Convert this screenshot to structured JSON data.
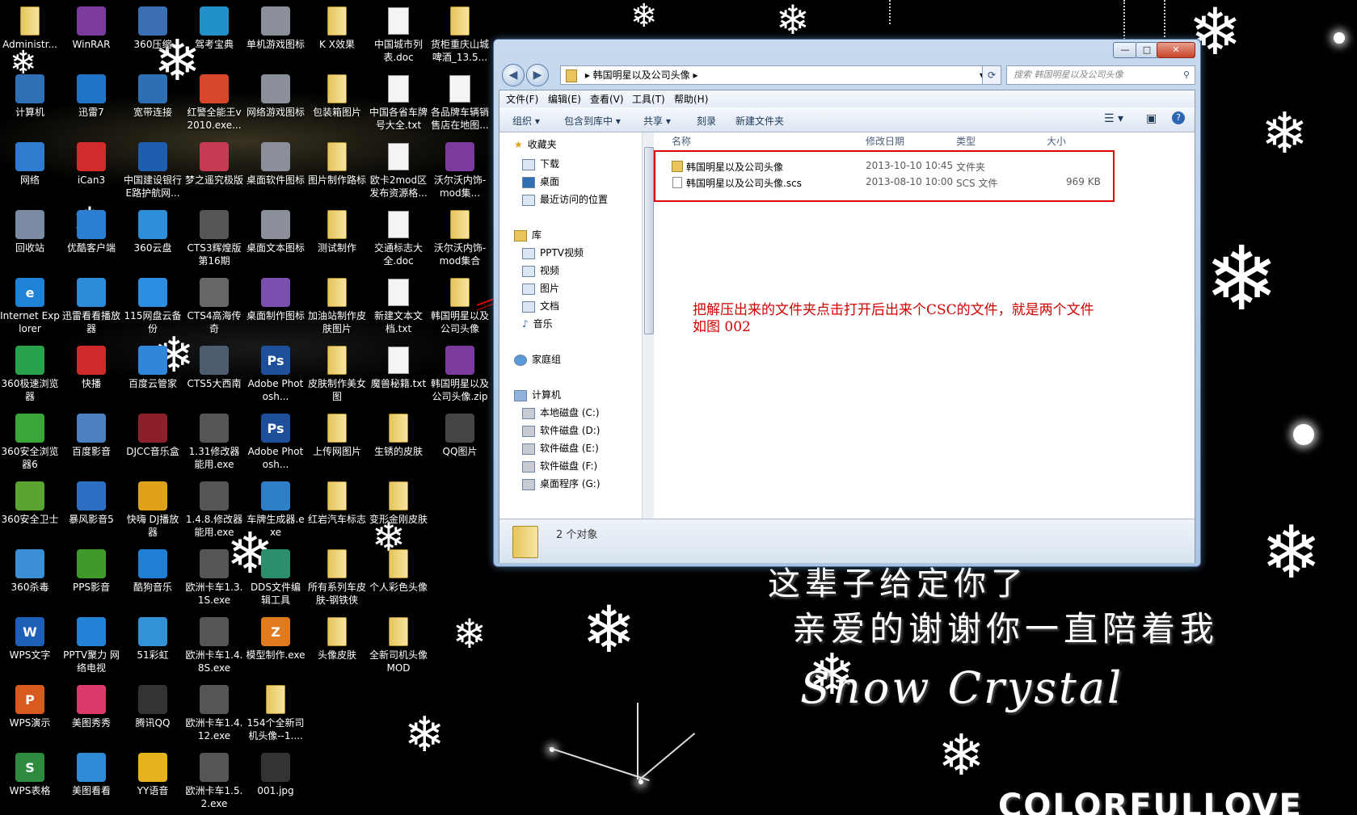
{
  "desktop_icons": [
    {
      "label": "Administr...",
      "kind": "folder"
    },
    {
      "label": "计算机",
      "kind": "app",
      "color": "#2f6fb5"
    },
    {
      "label": "网络",
      "kind": "app",
      "color": "#2e7bd0"
    },
    {
      "label": "回收站",
      "kind": "app",
      "color": "#7a8ba3"
    },
    {
      "label": "Internet Explorer",
      "kind": "app",
      "color": "#1e82d6",
      "glyph": "e"
    },
    {
      "label": "360极速浏览器",
      "kind": "app",
      "color": "#2aa24b"
    },
    {
      "label": "360安全浏览器6",
      "kind": "app",
      "color": "#3aa63a"
    },
    {
      "label": "360安全卫士",
      "kind": "app",
      "color": "#5aa531"
    },
    {
      "label": "360杀毒",
      "kind": "app",
      "color": "#3b8fd4"
    },
    {
      "label": "WPS文字",
      "kind": "app",
      "color": "#1e5fb8",
      "glyph": "W"
    },
    {
      "label": "WPS演示",
      "kind": "app",
      "color": "#d85a1f",
      "glyph": "P"
    },
    {
      "label": "WPS表格",
      "kind": "app",
      "color": "#2e8b3e",
      "glyph": "S"
    },
    {
      "label": "WinRAR",
      "kind": "app",
      "color": "#7b3b9e"
    },
    {
      "label": "迅雷7",
      "kind": "app",
      "color": "#1f74c7"
    },
    {
      "label": "iCan3",
      "kind": "app",
      "color": "#d22b2b"
    },
    {
      "label": "优酷客户端",
      "kind": "app",
      "color": "#2a7fd2"
    },
    {
      "label": "迅雷看看播放器",
      "kind": "app",
      "color": "#2c8ad8"
    },
    {
      "label": "快播",
      "kind": "app",
      "color": "#cf2a2a"
    },
    {
      "label": "百度影音",
      "kind": "app",
      "color": "#4a7fc0"
    },
    {
      "label": "暴风影音5",
      "kind": "app",
      "color": "#2d6fc3"
    },
    {
      "label": "PPS影音",
      "kind": "app",
      "color": "#3e9a2b"
    },
    {
      "label": "PPTV聚力 网络电视",
      "kind": "app",
      "color": "#2283d6"
    },
    {
      "label": "美图秀秀",
      "kind": "app",
      "color": "#d93a6a"
    },
    {
      "label": "美图看看",
      "kind": "app",
      "color": "#2f8ad6"
    },
    {
      "label": "360压缩",
      "kind": "app",
      "color": "#3b6fb4"
    },
    {
      "label": "宽带连接",
      "kind": "app",
      "color": "#2c6fb2"
    },
    {
      "label": "中国建设银行E路护航网...",
      "kind": "app",
      "color": "#1d5fae"
    },
    {
      "label": "360云盘",
      "kind": "app",
      "color": "#2d8ed9"
    },
    {
      "label": "115网盘云备份",
      "kind": "app",
      "color": "#2b8ee0"
    },
    {
      "label": "百度云管家",
      "kind": "app",
      "color": "#2f86db"
    },
    {
      "label": "DJCC音乐盒",
      "kind": "app",
      "color": "#8b1f2a"
    },
    {
      "label": "快嗨 DJ播放器",
      "kind": "app",
      "color": "#e0a21b"
    },
    {
      "label": "酷狗音乐",
      "kind": "app",
      "color": "#1f7fd5"
    },
    {
      "label": "51彩虹",
      "kind": "app",
      "color": "#3391d6"
    },
    {
      "label": "腾讯QQ",
      "kind": "app",
      "color": "#333333"
    },
    {
      "label": "YY语音",
      "kind": "app",
      "color": "#e6b31c"
    },
    {
      "label": "驾考宝典",
      "kind": "app",
      "color": "#2391c9"
    },
    {
      "label": "红警全能王v2010.exe...",
      "kind": "app",
      "color": "#d8462a"
    },
    {
      "label": "梦之遥究极版",
      "kind": "app",
      "color": "#c63a52"
    },
    {
      "label": "CTS3辉煌版第16期",
      "kind": "app",
      "color": "#555555"
    },
    {
      "label": "CTS4高海传奇",
      "kind": "app",
      "color": "#666666"
    },
    {
      "label": "CTS5大西南",
      "kind": "app",
      "color": "#4d5c6e"
    },
    {
      "label": "1.31修改器能用.exe",
      "kind": "app",
      "color": "#555555"
    },
    {
      "label": "1.4.8.修改器能用.exe",
      "kind": "app",
      "color": "#555555"
    },
    {
      "label": "欧洲卡车1.3.1S.exe",
      "kind": "app",
      "color": "#555555"
    },
    {
      "label": "欧洲卡车1.4.8S.exe",
      "kind": "app",
      "color": "#555555"
    },
    {
      "label": "欧洲卡车1.4.12.exe",
      "kind": "app",
      "color": "#555555"
    },
    {
      "label": "欧洲卡车1.5.2.exe",
      "kind": "app",
      "color": "#555555"
    },
    {
      "label": "单机游戏图标",
      "kind": "app",
      "color": "#8a8f99"
    },
    {
      "label": "网络游戏图标",
      "kind": "app",
      "color": "#8a8f99"
    },
    {
      "label": "桌面软件图标",
      "kind": "app",
      "color": "#8a8f99"
    },
    {
      "label": "桌面文本图标",
      "kind": "app",
      "color": "#8a8f99"
    },
    {
      "label": "桌面制作图标",
      "kind": "app",
      "color": "#7a4fb0"
    },
    {
      "label": "Adobe Photosh...",
      "kind": "app",
      "color": "#1d4f9a",
      "glyph": "Ps"
    },
    {
      "label": "Adobe Photosh...",
      "kind": "app",
      "color": "#1d4f9a",
      "glyph": "Ps"
    },
    {
      "label": "车牌生成器.exe",
      "kind": "app",
      "color": "#2d7fc8"
    },
    {
      "label": "DDS文件编辑工具",
      "kind": "app",
      "color": "#2b8f6c"
    },
    {
      "label": "模型制作.exe",
      "kind": "app",
      "color": "#e07a1f",
      "glyph": "Z"
    },
    {
      "label": "154个全新司机头像--1....",
      "kind": "folder"
    },
    {
      "label": "001.jpg",
      "kind": "app",
      "color": "#333333"
    },
    {
      "label": "K X效果",
      "kind": "folder"
    },
    {
      "label": "包装箱图片",
      "kind": "folder"
    },
    {
      "label": "图片制作路标",
      "kind": "folder"
    },
    {
      "label": "测试制作",
      "kind": "folder"
    },
    {
      "label": "加油站制作皮肤图片",
      "kind": "folder"
    },
    {
      "label": "皮肤制作美女图",
      "kind": "folder"
    },
    {
      "label": "上传网图片",
      "kind": "folder"
    },
    {
      "label": "红岩汽车标志",
      "kind": "folder"
    },
    {
      "label": "所有系列车皮肤-钢铁侠",
      "kind": "folder"
    },
    {
      "label": "头像皮肤",
      "kind": "folder"
    },
    {
      "label": "中国城市列表.doc",
      "kind": "doc"
    },
    {
      "label": "中国各省车牌号大全.txt",
      "kind": "doc"
    },
    {
      "label": "欧卡2mod区发布资源格...",
      "kind": "doc"
    },
    {
      "label": "交通标志大全.doc",
      "kind": "doc"
    },
    {
      "label": "新建文本文档.txt",
      "kind": "doc"
    },
    {
      "label": "魔兽秘籍.txt",
      "kind": "doc"
    },
    {
      "label": "生锈的皮肤",
      "kind": "folder"
    },
    {
      "label": "变形金刚皮肤",
      "kind": "folder"
    },
    {
      "label": "个人彩色头像",
      "kind": "folder"
    },
    {
      "label": "全新司机头像MOD",
      "kind": "folder"
    },
    {
      "label": "货柜重庆山城啤酒_13.5...",
      "kind": "folder"
    },
    {
      "label": "各品牌车辆销售店在地图...",
      "kind": "doc"
    },
    {
      "label": "沃尔沃内饰-mod集...",
      "kind": "app",
      "color": "#7b3b9e"
    },
    {
      "label": "沃尔沃内饰-mod集合",
      "kind": "folder"
    },
    {
      "label": "韩国明星以及公司头像",
      "kind": "folder"
    },
    {
      "label": "韩国明星以及公司头像.zip",
      "kind": "app",
      "color": "#7b3b9e"
    },
    {
      "label": "QQ图片",
      "kind": "app",
      "color": "#444444"
    }
  ],
  "poem": {
    "line1": "这辈子给定你了",
    "line2": "亲爱的谢谢你一直陪着我",
    "script": "Snow Crystal",
    "brand": "COLORFULLOVE"
  },
  "window": {
    "controls": {
      "minimize": "—",
      "maximize": "□",
      "close": "✕"
    },
    "back": "◀",
    "forward": "▶",
    "address_path": "韩国明星以及公司头像",
    "search_placeholder": "搜索 韩国明星以及公司头像",
    "menu": [
      "文件(F)",
      "编辑(E)",
      "查看(V)",
      "工具(T)",
      "帮助(H)"
    ],
    "toolbar": [
      "组织 ▾",
      "包含到库中 ▾",
      "共享 ▾",
      "刻录",
      "新建文件夹"
    ],
    "nav": {
      "favorites": "收藏夹",
      "downloads": "下载",
      "desktop": "桌面",
      "recent": "最近访问的位置",
      "libraries": "库",
      "pptv": "PPTV视频",
      "videos": "视频",
      "pictures": "图片",
      "documents": "文档",
      "music": "音乐",
      "homegroup": "家庭组",
      "computer": "计算机",
      "drive_c": "本地磁盘 (C:)",
      "drive_d": "软件磁盘 (D:)",
      "drive_e": "软件磁盘 (E:)",
      "drive_f": "软件磁盘 (F:)",
      "drive_g": "桌面程序 (G:)"
    },
    "columns": {
      "name": "名称",
      "date": "修改日期",
      "type": "类型",
      "size": "大小"
    },
    "files": [
      {
        "name": "韩国明星以及公司头像",
        "date": "2013-10-10 10:45",
        "type": "文件夹",
        "size": ""
      },
      {
        "name": "韩国明星以及公司头像.scs",
        "date": "2013-08-10 10:00",
        "type": "SCS 文件",
        "size": "969 KB"
      }
    ],
    "annotation_line1": "把解压出来的文件夹点击打开后出来个CSC的文件，就是两个文件",
    "annotation_line2": "如图  002",
    "status": "2 个对象"
  },
  "colors": {
    "annotation_red": "#e00000",
    "window_frame": "#aac4e3"
  }
}
